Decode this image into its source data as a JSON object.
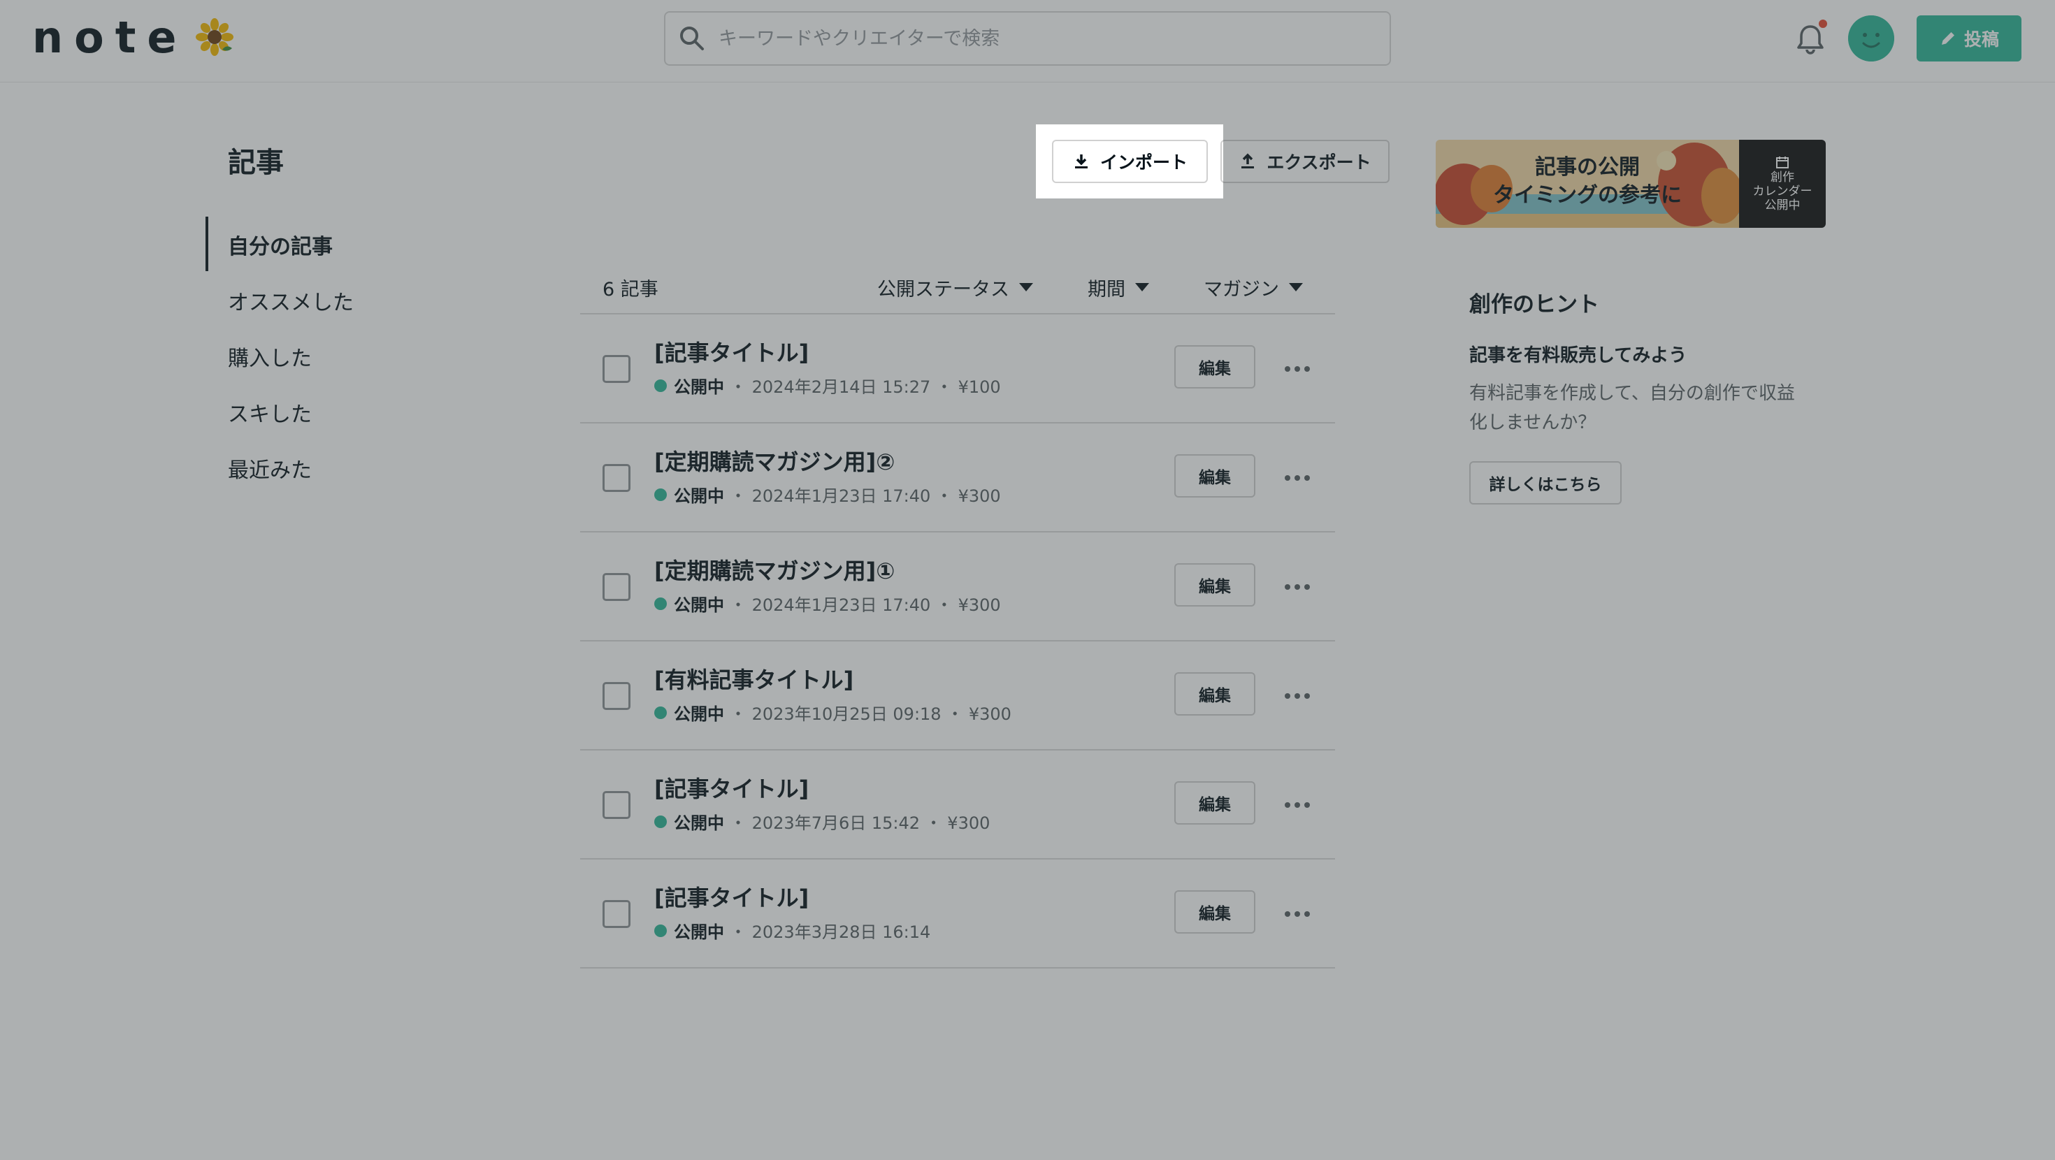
{
  "header": {
    "logo_text": "note",
    "search_placeholder": "キーワードやクリエイターで検索",
    "post_label": "投稿"
  },
  "sidebar": {
    "title": "記事",
    "items": [
      {
        "label": "自分の記事",
        "active": true
      },
      {
        "label": "オススメした",
        "active": false
      },
      {
        "label": "購入した",
        "active": false
      },
      {
        "label": "スキした",
        "active": false
      },
      {
        "label": "最近みた",
        "active": false
      }
    ]
  },
  "toolbar": {
    "import_label": "インポート",
    "export_label": "エクスポート"
  },
  "articles": {
    "count_label": "6 記事",
    "filters": [
      "公開ステータス",
      "期間",
      "マガジン"
    ],
    "edit_label": "編集",
    "rows": [
      {
        "title": "[記事タイトル]",
        "status": "公開中",
        "meta": "・ 2024年2月14日 15:27 ・ ¥100"
      },
      {
        "title": "[定期購読マガジン用]②",
        "status": "公開中",
        "meta": "・ 2024年1月23日 17:40 ・ ¥300"
      },
      {
        "title": "[定期購読マガジン用]①",
        "status": "公開中",
        "meta": "・ 2024年1月23日 17:40 ・ ¥300"
      },
      {
        "title": "[有料記事タイトル]",
        "status": "公開中",
        "meta": "・ 2023年10月25日 09:18 ・ ¥300"
      },
      {
        "title": "[記事タイトル]",
        "status": "公開中",
        "meta": "・ 2023年7月6日 15:42 ・ ¥300"
      },
      {
        "title": "[記事タイトル]",
        "status": "公開中",
        "meta": "・ 2023年3月28日 16:14"
      }
    ]
  },
  "banner": {
    "line1": "記事の公開",
    "line2": "タイミングの参考に",
    "side_line1": "創作",
    "side_line2": "カレンダー",
    "side_line3": "公開中"
  },
  "hints": {
    "title": "創作のヒント",
    "subtitle": "記事を有料販売してみよう",
    "body": "有料記事を作成して、自分の創作で収益化しませんか？",
    "button_label": "詳しくはこちら"
  },
  "colors": {
    "brand": "#2cb696",
    "notification": "#e5482f",
    "overlay": "rgba(60,66,70,0.42)"
  }
}
